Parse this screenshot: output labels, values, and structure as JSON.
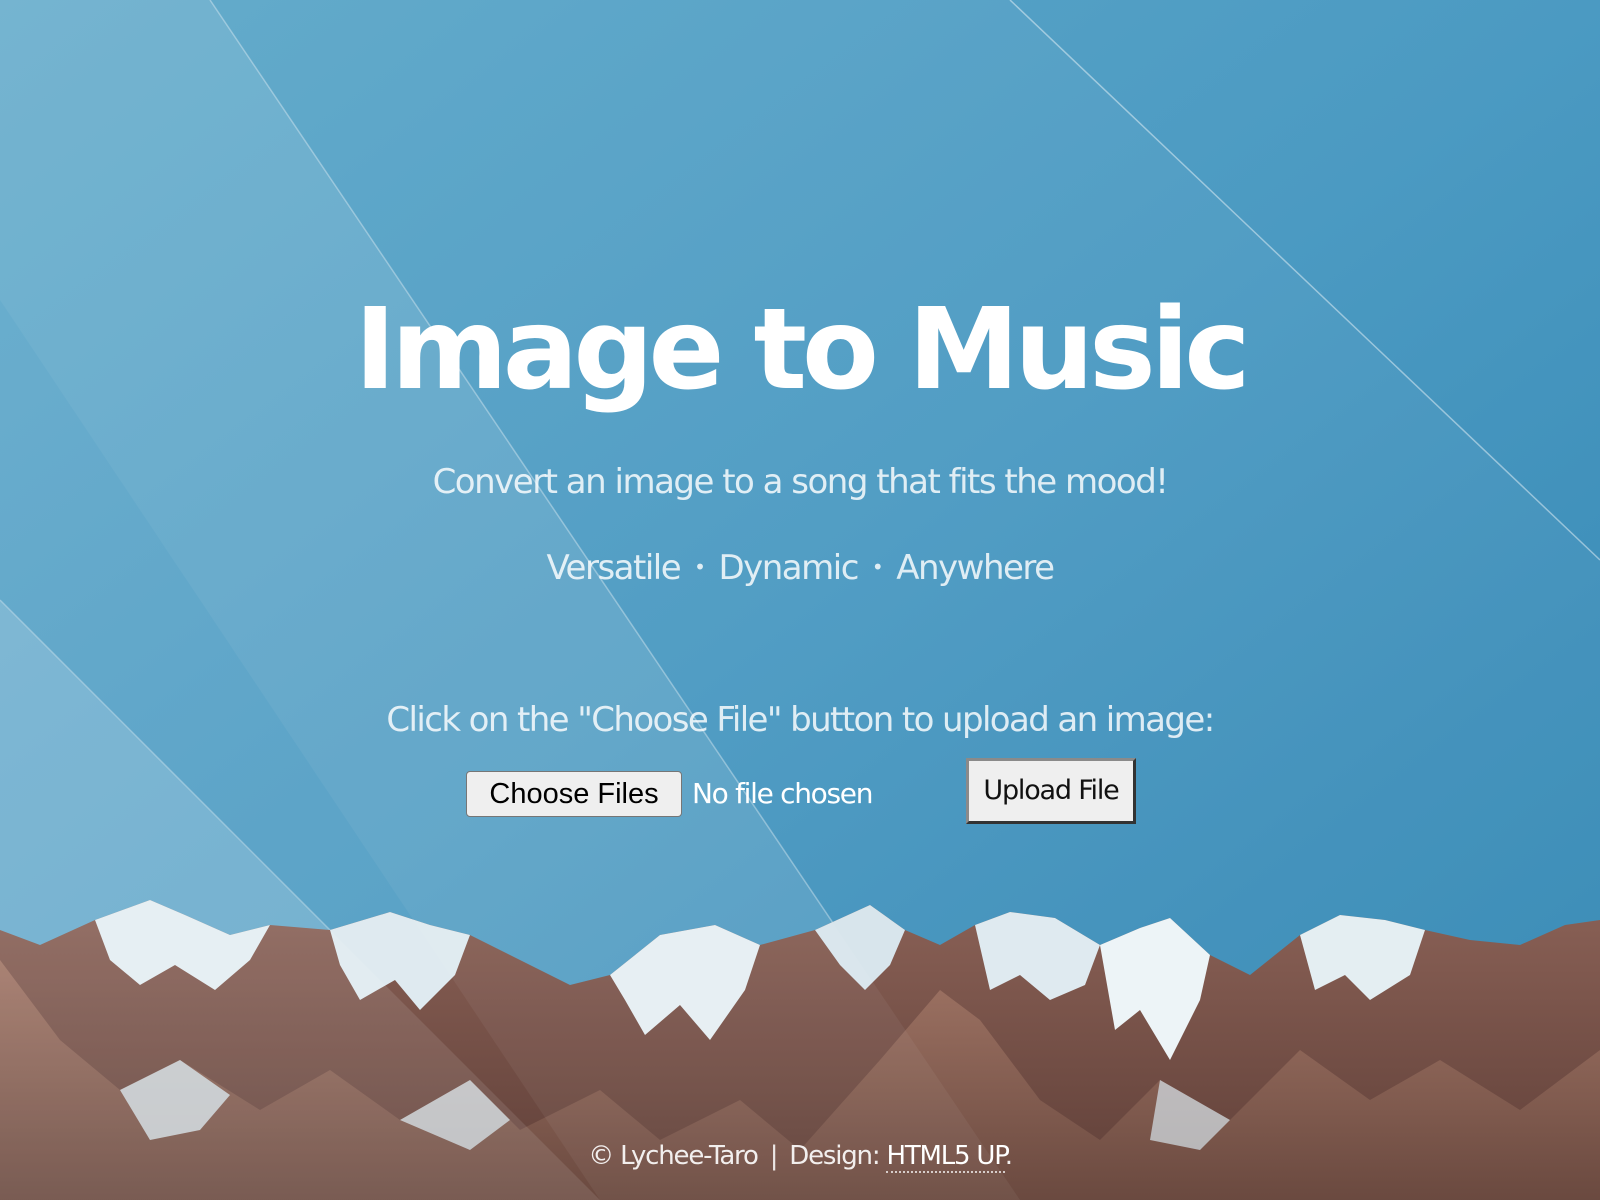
{
  "header": {
    "title": "Image to Music",
    "subtitle": "Convert an image to a song that fits the mood!"
  },
  "features": {
    "items": [
      "Versatile",
      "Dynamic",
      "Anywhere"
    ],
    "separator": "•"
  },
  "upload": {
    "instructions": "Click on the \"Choose File\" button to upload an image:",
    "choose_label": "Choose Files",
    "file_status": "No file chosen",
    "upload_label": "Upload File"
  },
  "footer": {
    "copyright": "© Lychee-Taro",
    "separator": "|",
    "design_prefix": "Design:",
    "design_link": "HTML5 UP",
    "design_suffix": "."
  },
  "colors": {
    "sky": "#4a98c0",
    "text": "#ffffff",
    "button_bg": "#efefef"
  },
  "icons": [
    "mountain-range-background"
  ]
}
